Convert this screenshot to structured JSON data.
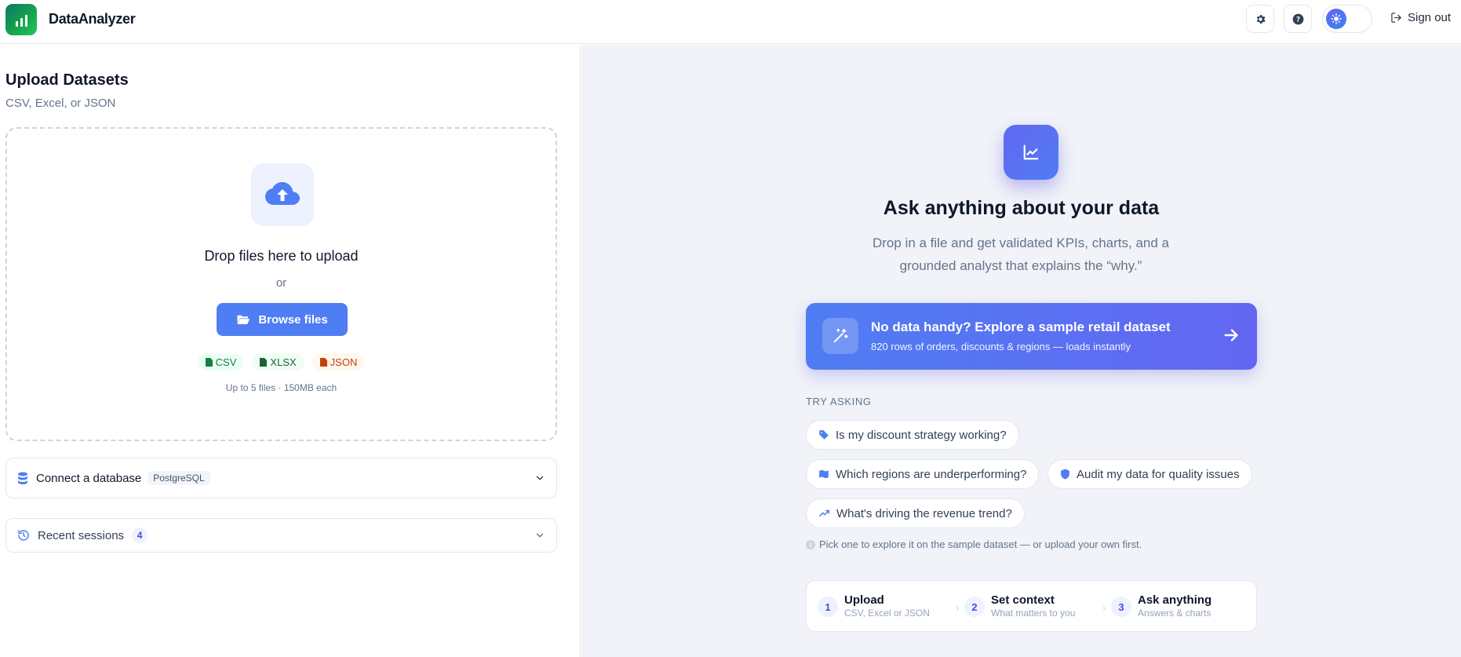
{
  "header": {
    "brand": "DataAnalyzer",
    "sign_out": "Sign out",
    "icons": [
      "settings-gear-icon",
      "help-icon",
      "theme-sun-icon",
      "sign-out-icon"
    ]
  },
  "upload": {
    "title": "Upload Datasets",
    "subtitle": "CSV, Excel, or JSON",
    "drop_text": "Drop files here to upload",
    "or": "or",
    "browse": "Browse files",
    "formats": [
      "CSV",
      "XLSX",
      "JSON"
    ],
    "limit": "Up to 5 files · 150MB each"
  },
  "database": {
    "label": "Connect a database",
    "tag": "PostgreSQL"
  },
  "recent": {
    "label": "Recent sessions",
    "count": "4"
  },
  "hero": {
    "title": "Ask anything about your data",
    "desc": "Drop in a file and get validated KPIs, charts, and a grounded analyst that explains the “why.”"
  },
  "sample": {
    "title": "No data handy? Explore a sample retail dataset",
    "subtitle": "820 rows of orders, discounts & regions — loads instantly"
  },
  "try": {
    "label": "TRY ASKING",
    "questions": [
      "Is my discount strategy working?",
      "Which regions are underperforming?",
      "Audit my data for quality issues",
      "What's driving the revenue trend?"
    ],
    "hint": "Pick one to explore it on the sample dataset — or upload your own first."
  },
  "steps": [
    {
      "num": "1",
      "title": "Upload",
      "desc": "CSV, Excel or JSON"
    },
    {
      "num": "2",
      "title": "Set context",
      "desc": "What matters to you"
    },
    {
      "num": "3",
      "title": "Ask anything",
      "desc": "Answers & charts"
    }
  ],
  "colors": {
    "accent": "#4f7df3",
    "accent2": "#6366f1",
    "panel_bg": "#f1f3f8"
  }
}
